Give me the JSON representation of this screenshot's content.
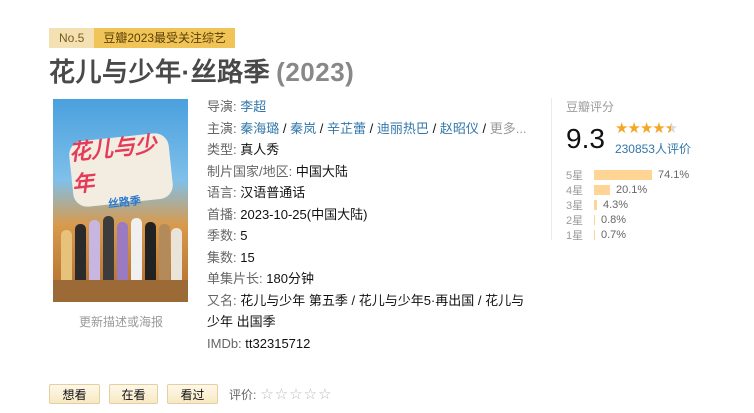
{
  "badge": {
    "rank": "No.5",
    "tag": "豆瓣2023最受关注综艺"
  },
  "title": {
    "name": "花儿与少年·丝路季",
    "year": "(2023)"
  },
  "poster": {
    "logo_main": "花儿与少年",
    "logo_sub": "丝路季",
    "update_link": "更新描述或海报"
  },
  "info": {
    "director": {
      "label": "导演:",
      "value": "李超"
    },
    "cast": {
      "label": "主演:",
      "names": [
        "秦海璐",
        "秦岚",
        "辛芷蕾",
        "迪丽热巴",
        "赵昭仪"
      ],
      "more": "更多..."
    },
    "type": {
      "label": "类型:",
      "value": "真人秀"
    },
    "region": {
      "label": "制片国家/地区:",
      "value": "中国大陆"
    },
    "language": {
      "label": "语言:",
      "value": "汉语普通话"
    },
    "premiere": {
      "label": "首播:",
      "value": "2023-10-25(中国大陆)"
    },
    "seasons": {
      "label": "季数:",
      "value": "5"
    },
    "episodes": {
      "label": "集数:",
      "value": "15"
    },
    "runtime": {
      "label": "单集片长:",
      "value": "180分钟"
    },
    "aka": {
      "label": "又名:",
      "value": "花儿与少年 第五季 / 花儿与少年5·再出国 / 花儿与少年 出国季"
    },
    "imdb": {
      "label": "IMDb:",
      "value": "tt32315712"
    }
  },
  "rating": {
    "title": "豆瓣评分",
    "score": "9.3",
    "stars_value": 4.5,
    "votes": "230853人评价",
    "distribution": [
      {
        "label": "5星",
        "pct": "74.1%",
        "value": 74.1
      },
      {
        "label": "4星",
        "pct": "20.1%",
        "value": 20.1
      },
      {
        "label": "3星",
        "pct": "4.3%",
        "value": 4.3
      },
      {
        "label": "2星",
        "pct": "0.8%",
        "value": 0.8
      },
      {
        "label": "1星",
        "pct": "0.7%",
        "value": 0.7
      }
    ],
    "bar_color": "#ffd596"
  },
  "actions": {
    "want": "想看",
    "watching": "在看",
    "watched": "看过",
    "rate_label": "评价:",
    "empty_stars": "☆☆☆☆☆"
  },
  "colors": {
    "link": "#3377aa",
    "badge_tag": "#f0c456",
    "star": "#f5a623"
  }
}
